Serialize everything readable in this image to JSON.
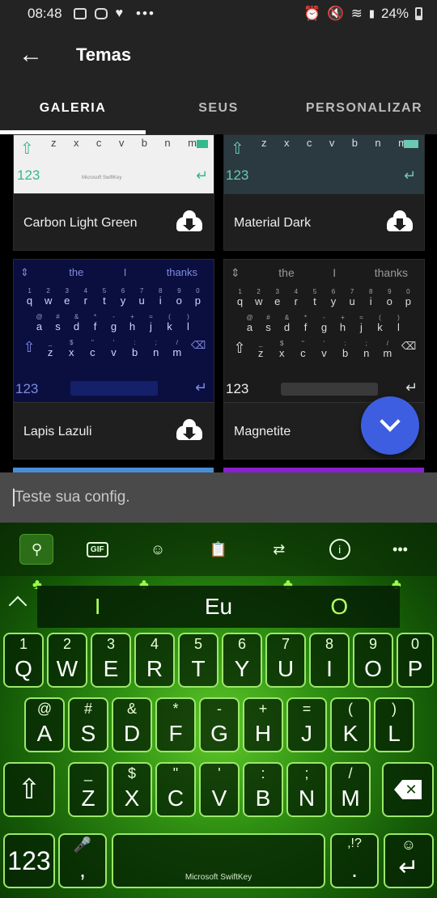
{
  "status": {
    "time": "08:48",
    "dots": "•••",
    "battery": "24%"
  },
  "appbar": {
    "title": "Temas"
  },
  "tabs": [
    {
      "label": "GALERIA"
    },
    {
      "label": "SEUS"
    },
    {
      "label": "PERSONALIZAR"
    }
  ],
  "themes": [
    {
      "name": "Carbon Light Green"
    },
    {
      "name": "Material Dark"
    },
    {
      "name": "Lapis Lazuli"
    },
    {
      "name": "Magnetite"
    }
  ],
  "preview": {
    "suggest": [
      "the",
      "I",
      "thanks"
    ],
    "num_key": "123",
    "brand": "Microsoft SwiftKey",
    "row1_sec": [
      "1",
      "2",
      "3",
      "4",
      "5",
      "6",
      "7",
      "8",
      "9",
      "0"
    ],
    "row1": [
      "q",
      "w",
      "e",
      "r",
      "t",
      "y",
      "u",
      "i",
      "o",
      "p"
    ],
    "row2_sec": [
      "@",
      "#",
      "&",
      "*",
      "-",
      "+",
      "=",
      "(",
      ")"
    ],
    "row2": [
      "a",
      "s",
      "d",
      "f",
      "g",
      "h",
      "j",
      "k",
      "l"
    ],
    "row3_sec": [
      "_",
      "$",
      "\"",
      "'",
      ":",
      ";",
      "/"
    ],
    "row3": [
      "z",
      "x",
      "c",
      "v",
      "b",
      "n",
      "m"
    ]
  },
  "input": {
    "placeholder": "Teste sua config."
  },
  "toolbar": {
    "gif_label": "GIF",
    "info_label": "i",
    "more_label": "•••"
  },
  "suggestions": [
    "I",
    "Eu",
    "O"
  ],
  "keys": {
    "row1": [
      {
        "sec": "1",
        "pri": "Q"
      },
      {
        "sec": "2",
        "pri": "W"
      },
      {
        "sec": "3",
        "pri": "E"
      },
      {
        "sec": "4",
        "pri": "R"
      },
      {
        "sec": "5",
        "pri": "T"
      },
      {
        "sec": "6",
        "pri": "Y"
      },
      {
        "sec": "7",
        "pri": "U"
      },
      {
        "sec": "8",
        "pri": "I"
      },
      {
        "sec": "9",
        "pri": "O"
      },
      {
        "sec": "0",
        "pri": "P"
      }
    ],
    "row2": [
      {
        "sec": "@",
        "pri": "A"
      },
      {
        "sec": "#",
        "pri": "S"
      },
      {
        "sec": "&",
        "pri": "D"
      },
      {
        "sec": "*",
        "pri": "F"
      },
      {
        "sec": "-",
        "pri": "G"
      },
      {
        "sec": "+",
        "pri": "H"
      },
      {
        "sec": "=",
        "pri": "J"
      },
      {
        "sec": "(",
        "pri": "K"
      },
      {
        "sec": ")",
        "pri": "L"
      }
    ],
    "row3": [
      {
        "sec": "_",
        "pri": "Z"
      },
      {
        "sec": "$",
        "pri": "X"
      },
      {
        "sec": "\"",
        "pri": "C"
      },
      {
        "sec": "'",
        "pri": "V"
      },
      {
        "sec": ":",
        "pri": "B"
      },
      {
        "sec": ";",
        "pri": "N"
      },
      {
        "sec": "/",
        "pri": "M"
      }
    ],
    "num_label": "123",
    "comma_label": ",",
    "punct_label": ",!?",
    "period_label": ".",
    "space_brand": "Microsoft SwiftKey"
  }
}
